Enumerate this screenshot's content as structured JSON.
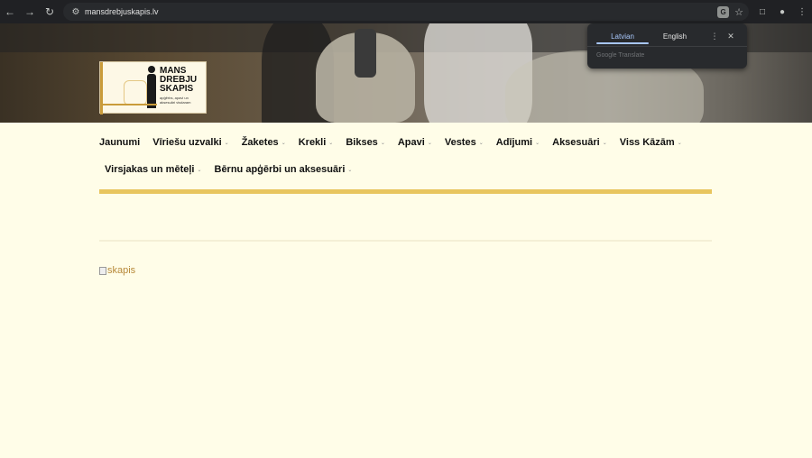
{
  "browser": {
    "url": "mansdrebjuskapis.lv",
    "translate_popup": {
      "tabs": [
        "Latvian",
        "English"
      ],
      "active_tab": "Latvian",
      "label": "Google Translate"
    }
  },
  "logo": {
    "line1": "MANS",
    "line2": "DREBJU",
    "line3": "SKAPIS",
    "tagline": "apģērbs, apavi un aksesuāri visdaram"
  },
  "nav": {
    "row1": [
      {
        "label": "Jaunumi",
        "has_dropdown": false
      },
      {
        "label": "Vīriešu uzvalki",
        "has_dropdown": true
      },
      {
        "label": "Žaketes",
        "has_dropdown": true
      },
      {
        "label": "Krekli",
        "has_dropdown": true
      },
      {
        "label": "Bikses",
        "has_dropdown": true
      },
      {
        "label": "Apavi",
        "has_dropdown": true
      },
      {
        "label": "Vestes",
        "has_dropdown": true
      },
      {
        "label": "Adījumi",
        "has_dropdown": true
      },
      {
        "label": "Aksesuāri",
        "has_dropdown": true
      },
      {
        "label": "Viss Kāzām",
        "has_dropdown": true
      }
    ],
    "row2": [
      {
        "label": "Virsjakas un mēteļi",
        "has_dropdown": true
      },
      {
        "label": "Bērnu apģērbi un aksesuāri",
        "has_dropdown": true
      }
    ]
  },
  "content": {
    "image_alt": "skapis"
  },
  "colors": {
    "page_bg": "#fffde8",
    "accent_gold": "#e8c55e",
    "link_color": "#b7893a"
  }
}
